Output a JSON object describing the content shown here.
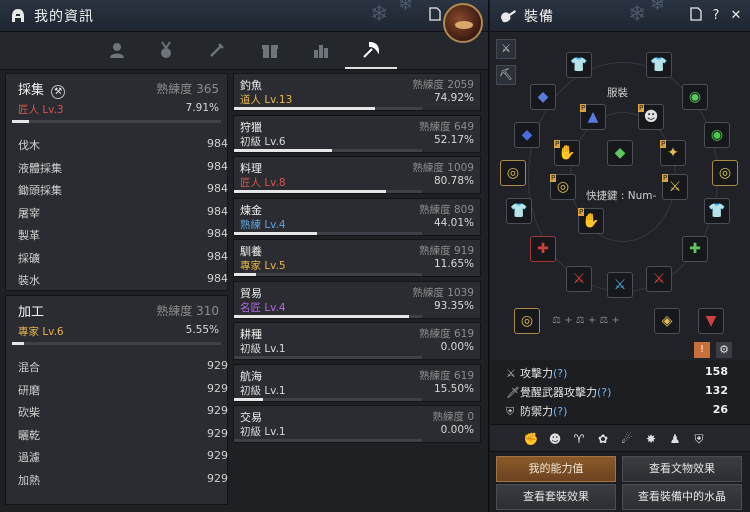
{
  "left": {
    "title": "我的資訊",
    "categories": [
      {
        "name": "採集",
        "prof_label": "熟練度",
        "prof_value": "365",
        "level": "匠人 Lv.3",
        "level_color": "#d9534f",
        "pct": "7.91%",
        "progress": 0.0791,
        "items": [
          {
            "name": "伐木",
            "value": "984"
          },
          {
            "name": "液體採集",
            "value": "984"
          },
          {
            "name": "鋤頭採集",
            "value": "984"
          },
          {
            "name": "屠宰",
            "value": "984"
          },
          {
            "name": "製革",
            "value": "984"
          },
          {
            "name": "採礦",
            "value": "984"
          },
          {
            "name": "裝水",
            "value": "984"
          }
        ]
      },
      {
        "name": "加工",
        "prof_label": "熟練度",
        "prof_value": "310",
        "level": "專家 Lv.6",
        "level_color": "#e8b64a",
        "pct": "5.55%",
        "progress": 0.0555,
        "items": [
          {
            "name": "混合",
            "value": "929"
          },
          {
            "name": "研磨",
            "value": "929"
          },
          {
            "name": "砍柴",
            "value": "929"
          },
          {
            "name": "曬乾",
            "value": "929"
          },
          {
            "name": "過濾",
            "value": "929"
          },
          {
            "name": "加熱",
            "value": "929"
          }
        ]
      }
    ],
    "skills": [
      {
        "name": "釣魚",
        "prof_label": "熟練度",
        "prof_value": "2059",
        "level": "道人 Lv.13",
        "level_color": "#e8b64a",
        "pct": "74.92%",
        "progress": 0.7492
      },
      {
        "name": "狩獵",
        "prof_label": "熟練度",
        "prof_value": "649",
        "level": "初級 Lv.6",
        "level_color": "#d8d8d8",
        "pct": "52.17%",
        "progress": 0.5217
      },
      {
        "name": "料理",
        "prof_label": "熟練度",
        "prof_value": "1009",
        "level": "匠人 Lv.8",
        "level_color": "#d9534f",
        "pct": "80.78%",
        "progress": 0.8078
      },
      {
        "name": "煉金",
        "prof_label": "熟練度",
        "prof_value": "809",
        "level": "熟練 Lv.4",
        "level_color": "#5ea3e0",
        "pct": "44.01%",
        "progress": 0.4401
      },
      {
        "name": "馴養",
        "prof_label": "熟練度",
        "prof_value": "919",
        "level": "專家 Lv.5",
        "level_color": "#e8b64a",
        "pct": "11.65%",
        "progress": 0.1165
      },
      {
        "name": "貿易",
        "prof_label": "熟練度",
        "prof_value": "1039",
        "level": "名匠 Lv.4",
        "level_color": "#b06ae0",
        "pct": "93.35%",
        "progress": 0.9335
      },
      {
        "name": "耕種",
        "prof_label": "熟練度",
        "prof_value": "619",
        "level": "初級 Lv.1",
        "level_color": "#d8d8d8",
        "pct": "0.00%",
        "progress": 0.0
      },
      {
        "name": "航海",
        "prof_label": "熟練度",
        "prof_value": "619",
        "level": "初級 Lv.1",
        "level_color": "#d8d8d8",
        "pct": "15.50%",
        "progress": 0.155
      },
      {
        "name": "交易",
        "prof_label": "熟練度",
        "prof_value": "0",
        "level": "初級 Lv.1",
        "level_color": "#d8d8d8",
        "pct": "0.00%",
        "progress": 0.0
      }
    ]
  },
  "right": {
    "title": "裝備",
    "costume_label": "服裝",
    "shortcut_label": "快捷鍵 : Num-",
    "stats": [
      {
        "label": "攻擊力",
        "hint": "(?)",
        "value": "158"
      },
      {
        "label": "覺醒武器攻擊力",
        "hint": "(?)",
        "value": "132"
      },
      {
        "label": "防禦力",
        "hint": "(?)",
        "value": "26"
      }
    ],
    "buttons": {
      "my_ability": "我的能力值",
      "artifact_effect": "查看文物效果",
      "set_effect": "查看套裝效果",
      "crystals": "查看裝備中的水晶"
    }
  }
}
